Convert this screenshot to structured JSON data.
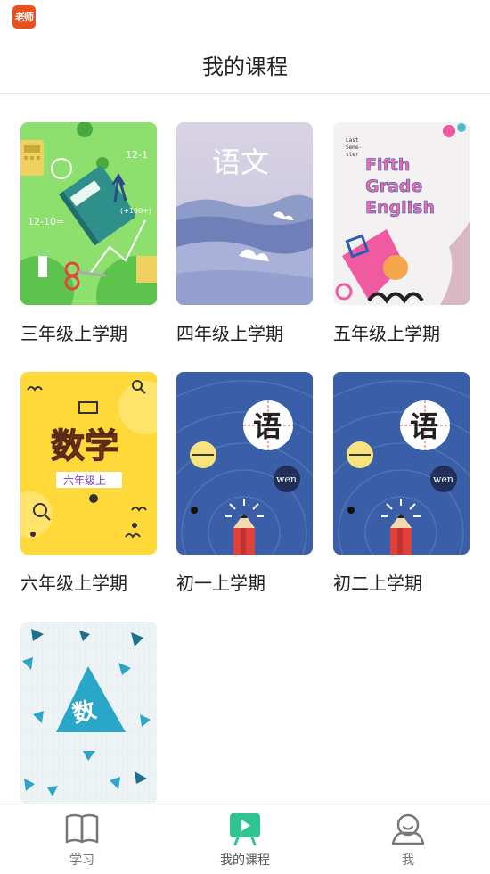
{
  "status_bar": {
    "app_badge": "老师"
  },
  "header": {
    "title": "我的课程"
  },
  "courses": [
    {
      "title": "三年级上学期",
      "cover_icon": "math-supplies-cover"
    },
    {
      "title": "四年级上学期",
      "cover_icon": "chinese-cranes-cover",
      "cover_text": "语文"
    },
    {
      "title": "五年级上学期",
      "cover_icon": "english-cover",
      "cover_text": [
        "Fifth",
        "Grade",
        "English"
      ],
      "cover_small": [
        "Last",
        "Seme-",
        "ster"
      ]
    },
    {
      "title": "六年级上学期",
      "cover_icon": "math-yellow-cover",
      "cover_text": "数学",
      "cover_sub": "六年级上"
    },
    {
      "title": "初一上学期",
      "cover_icon": "chinese-pencil-cover",
      "cover_text": "语",
      "cover_pinyin": "wen"
    },
    {
      "title": "初二上学期",
      "cover_icon": "chinese-pencil-cover",
      "cover_text": "语",
      "cover_pinyin": "wen"
    },
    {
      "title": "",
      "cover_icon": "math-triangle-cover",
      "cover_text": "数"
    }
  ],
  "tabs": [
    {
      "label": "学习",
      "icon": "book-icon",
      "active": false
    },
    {
      "label": "我的课程",
      "icon": "play-board-icon",
      "active": true
    },
    {
      "label": "我",
      "icon": "person-icon",
      "active": false
    }
  ],
  "colors": {
    "accent": "#2fc491",
    "badge": "#e8501c",
    "blue_cover": "#3a5fa8",
    "green_cover": "#8ee06e",
    "yellow_cover": "#ffd83a"
  }
}
